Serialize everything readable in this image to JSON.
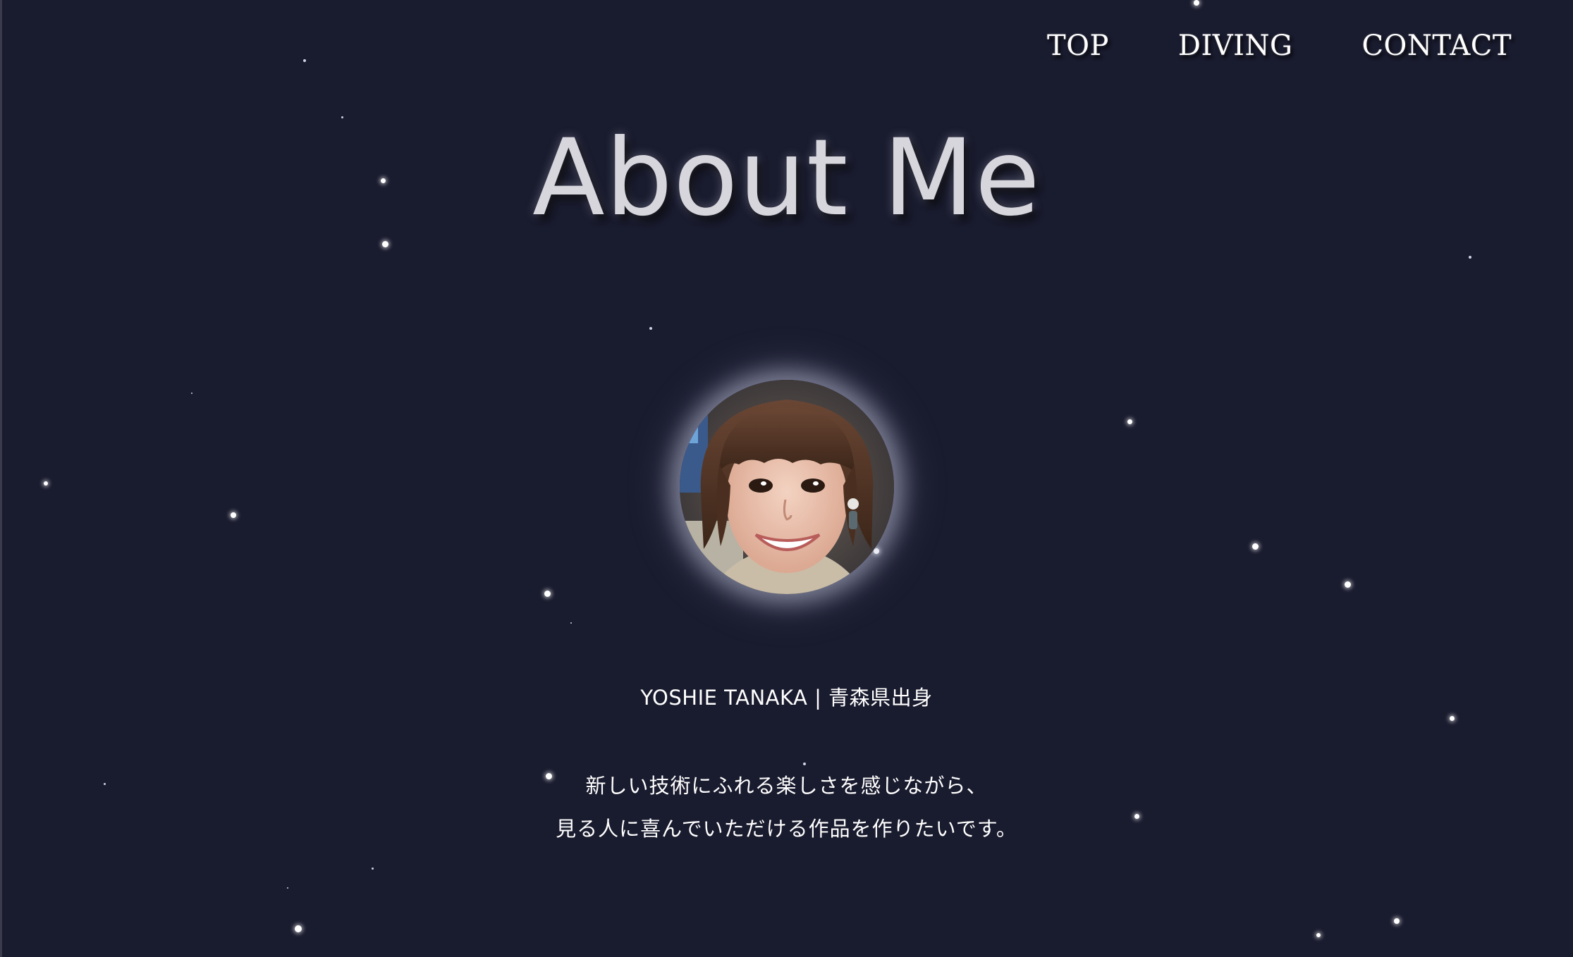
{
  "nav": {
    "items": [
      {
        "label": "TOP"
      },
      {
        "label": "DIVING"
      },
      {
        "label": "CONTACT"
      }
    ]
  },
  "hero": {
    "title": "About Me"
  },
  "profile": {
    "avatar_icon": "profile-photo",
    "name_line": "YOSHIE TANAKA | 青森県出身",
    "bio_lines": [
      "新しい技術にふれる楽しさを感じながら、",
      "見る人に喜んでいただける作品を作りたいです。"
    ]
  },
  "colors": {
    "background": "#191b2e",
    "title": "#d7d6dd",
    "text": "#ffffff"
  }
}
